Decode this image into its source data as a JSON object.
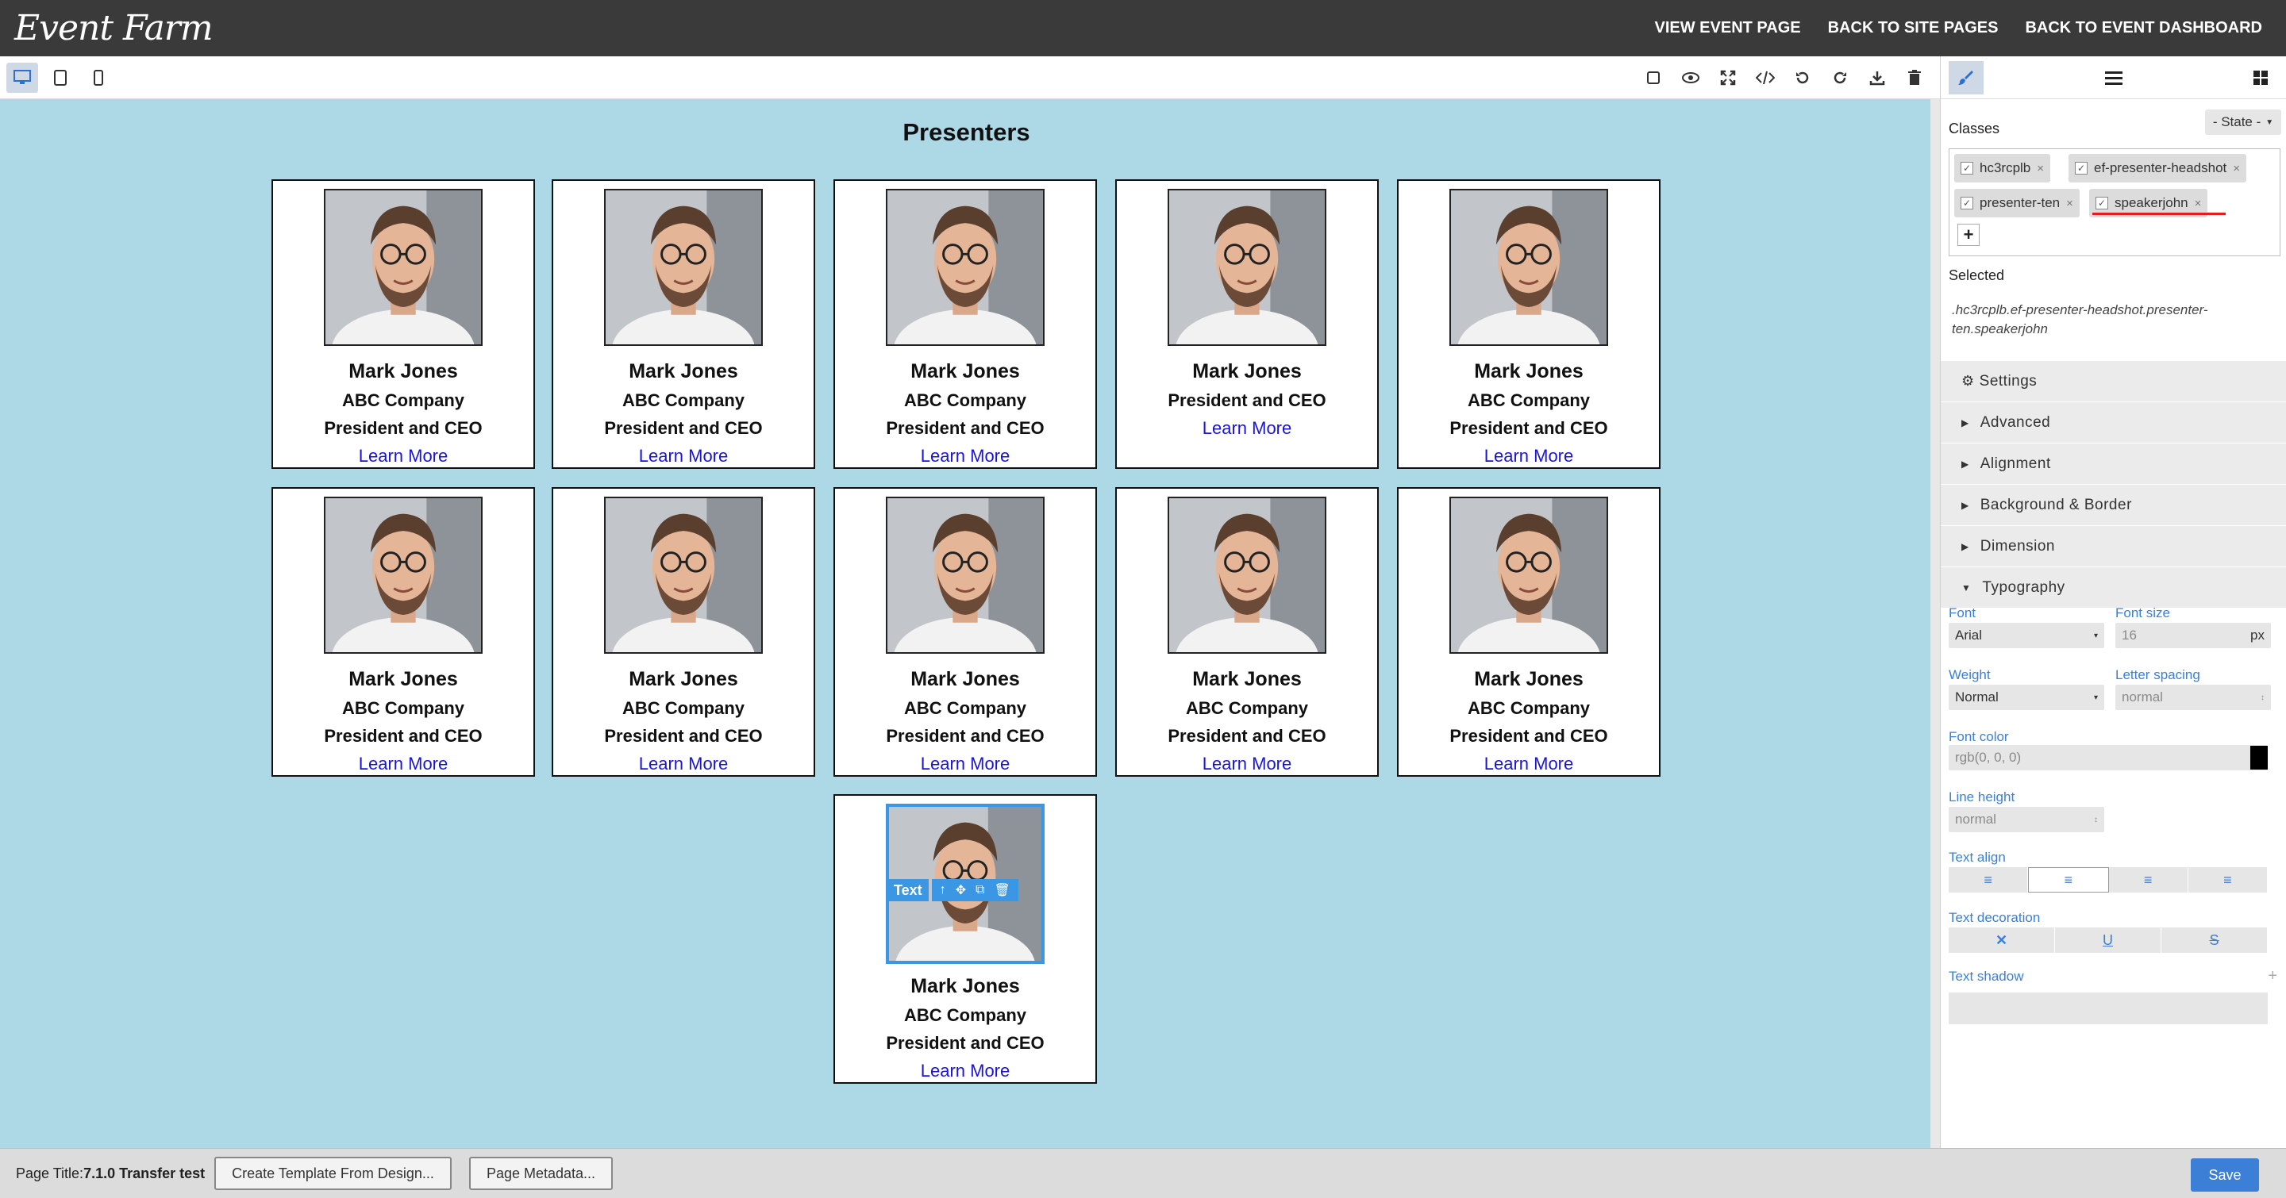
{
  "app": {
    "logo": "Event Farm"
  },
  "header": {
    "links": [
      "VIEW EVENT PAGE",
      "BACK TO SITE PAGES",
      "BACK TO EVENT DASHBOARD"
    ]
  },
  "toolbar": {
    "devices": [
      "desktop-icon",
      "tablet-icon",
      "mobile-icon"
    ],
    "actions": [
      "square-outline-icon",
      "eye-icon",
      "fullscreen-icon",
      "code-icon",
      "undo-icon",
      "redo-icon",
      "download-icon",
      "trash-icon"
    ]
  },
  "canvas": {
    "section_title": "Presenters",
    "selection": {
      "label": "Text"
    },
    "cards": [
      {
        "name": "Mark Jones",
        "company": "ABC Company",
        "title": "President and CEO",
        "link": "Learn More"
      },
      {
        "name": "Mark Jones",
        "company": "ABC Company",
        "title": "President and CEO",
        "link": "Learn More"
      },
      {
        "name": "Mark Jones",
        "company": "ABC Company",
        "title": "President and CEO",
        "link": "Learn More"
      },
      {
        "name": "Mark Jones",
        "company": "President and CEO",
        "title": "",
        "link": "Learn More"
      },
      {
        "name": "Mark Jones",
        "company": "ABC Company",
        "title": "President and CEO",
        "link": "Learn More"
      },
      {
        "name": "Mark Jones",
        "company": "ABC Company",
        "title": "President and CEO",
        "link": "Learn More"
      },
      {
        "name": "Mark Jones",
        "company": "ABC Company",
        "title": "President and CEO",
        "link": "Learn More"
      },
      {
        "name": "Mark Jones",
        "company": "ABC Company",
        "title": "President and CEO",
        "link": "Learn More"
      },
      {
        "name": "Mark Jones",
        "company": "ABC Company",
        "title": "President and CEO",
        "link": "Learn More"
      },
      {
        "name": "Mark Jones",
        "company": "ABC Company",
        "title": "President and CEO",
        "link": "Learn More"
      },
      {
        "name": "Mark Jones",
        "company": "ABC Company",
        "title": "President and CEO",
        "link": "Learn More"
      }
    ]
  },
  "panel": {
    "tabs": [
      "paintbrush-icon",
      "menu-icon",
      "blocks-icon"
    ],
    "classes_label": "Classes",
    "state_select": "- State -",
    "class_tags": [
      "hc3rcplb",
      "ef-presenter-headshot",
      "presenter-ten",
      "speakerjohn"
    ],
    "selected_label": "Selected",
    "selected_value": ".hc3rcplb.ef-presenter-headshot.presenter-ten.speakerjohn",
    "sections": {
      "settings": "Settings",
      "advanced": "Advanced",
      "alignment": "Alignment",
      "background_border": "Background & Border",
      "dimension": "Dimension",
      "typography": "Typography"
    },
    "typography": {
      "font_label": "Font",
      "font_value": "Arial",
      "font_size_label": "Font size",
      "font_size_value": "16",
      "font_size_unit": "px",
      "weight_label": "Weight",
      "weight_value": "Normal",
      "letter_spacing_label": "Letter spacing",
      "letter_spacing_value": "normal",
      "font_color_label": "Font color",
      "font_color_value": "rgb(0, 0, 0)",
      "font_color_hex": "#000000",
      "line_height_label": "Line height",
      "line_height_value": "normal",
      "text_align_label": "Text align",
      "text_decoration_label": "Text decoration",
      "text_shadow_label": "Text shadow"
    }
  },
  "footer": {
    "page_title_label": "Page Title:",
    "page_title_value": "7.1.0 Transfer test",
    "create_template": "Create Template From Design...",
    "page_metadata": "Page Metadata...",
    "save": "Save"
  },
  "colors": {
    "canvas_bg": "#add8e6",
    "accent": "#3b7fd6",
    "link": "#1a14d6",
    "selection": "#3b97e3"
  }
}
